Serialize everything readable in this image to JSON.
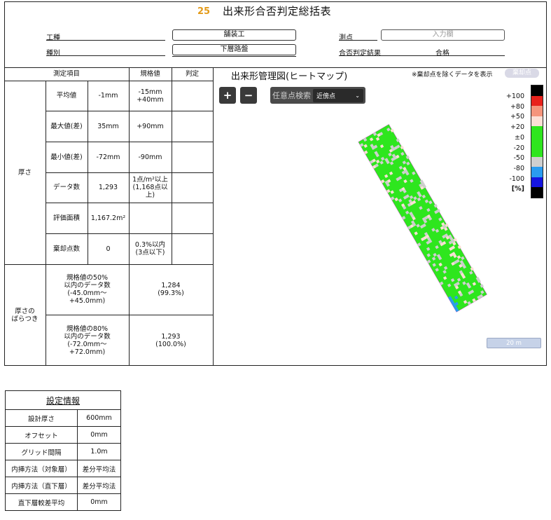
{
  "header": {
    "number": "25",
    "title": "出来形合否判定総括表",
    "fields": {
      "koushu_label": "工種",
      "koushu_value": "舗装工",
      "shubetsu_label": "種別",
      "shubetsu_value": "下層路盤",
      "sokuten_label": "測点",
      "sokuten_placeholder": "入力欄",
      "result_label": "合否判定結果",
      "result_value": "合格"
    }
  },
  "table": {
    "headers": {
      "item": "測定項目",
      "spec": "規格値",
      "judge": "判定"
    },
    "thickness_label": "厚さ",
    "rows": [
      {
        "label": "平均値",
        "value": "-1mm",
        "spec": "-15mm\n+40mm",
        "judge": ""
      },
      {
        "label": "最大値(差)",
        "value": "35mm",
        "spec": "+90mm",
        "judge": ""
      },
      {
        "label": "最小値(差)",
        "value": "-72mm",
        "spec": "-90mm",
        "judge": ""
      },
      {
        "label": "データ数",
        "value": "1,293",
        "spec": "1点/m²以上\n(1,168点以\n上)",
        "judge": ""
      },
      {
        "label": "評価面積",
        "value": "1,167.2m²",
        "spec": "",
        "judge": ""
      },
      {
        "label": "棄却点数",
        "value": "0",
        "spec": "0.3%以内\n(3点以下)",
        "judge": ""
      }
    ],
    "variation_label": "厚さの\nばらつき",
    "variation_rows": [
      {
        "label": "規格値の50%\n以内のデータ数\n(-45.0mm～\n+45.0mm)",
        "value": "1,284\n(99.3%)"
      },
      {
        "label": "規格値の80%\n以内のデータ数\n(-72.0mm～\n+72.0mm)",
        "value": "1,293\n(100.0%)"
      }
    ]
  },
  "map": {
    "title": "出来形管理図(ヒートマップ)",
    "note": "※棄却点を除くデータを表示",
    "reject_button": "棄却点",
    "zoom_in": "+",
    "zoom_out": "−",
    "search_label": "任意点検索",
    "search_select_value": "近傍点",
    "scale_label": "20 m",
    "legend": [
      {
        "label": "+100",
        "color": "#000000"
      },
      {
        "label": "+80",
        "color": "#e8221c"
      },
      {
        "label": "+50",
        "color": "#f5957c"
      },
      {
        "label": "+20",
        "color": "#fde0d6"
      },
      {
        "label": "±0",
        "color": "#2ee61e"
      },
      {
        "label": "-20",
        "color": "#2ee61e"
      },
      {
        "label": "-50",
        "color": "#cfcfcf"
      },
      {
        "label": "-80",
        "color": "#2a9cf0"
      },
      {
        "label": "-100",
        "color": "#1515e0"
      },
      {
        "label": "[%]",
        "color": "#000000"
      }
    ]
  },
  "settings": {
    "title": "設定情報",
    "rows": [
      {
        "label": "設計厚さ",
        "value": "600mm"
      },
      {
        "label": "オフセット",
        "value": "0mm"
      },
      {
        "label": "グリッド間隔",
        "value": "1.0m"
      },
      {
        "label": "内挿方法（対象層）",
        "value": "差分平均法"
      },
      {
        "label": "内挿方法（直下層）",
        "value": "差分平均法"
      },
      {
        "label": "直下層較差平均",
        "value": "0mm"
      }
    ]
  }
}
